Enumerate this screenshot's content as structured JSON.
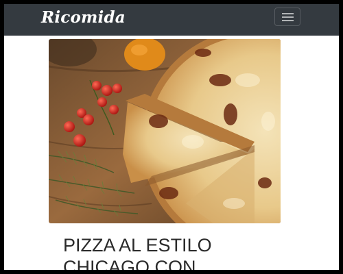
{
  "navbar": {
    "brand": "Ricomida",
    "toggler_icon": "hamburger-menu-icon"
  },
  "hero": {
    "image_subject": "pizza"
  },
  "article": {
    "title": "PIZZA AL ESTILO CHICAGO CON"
  },
  "colors": {
    "navbar_bg": "#343a40",
    "page_bg": "#ffffff",
    "frame_bg": "#000000"
  }
}
